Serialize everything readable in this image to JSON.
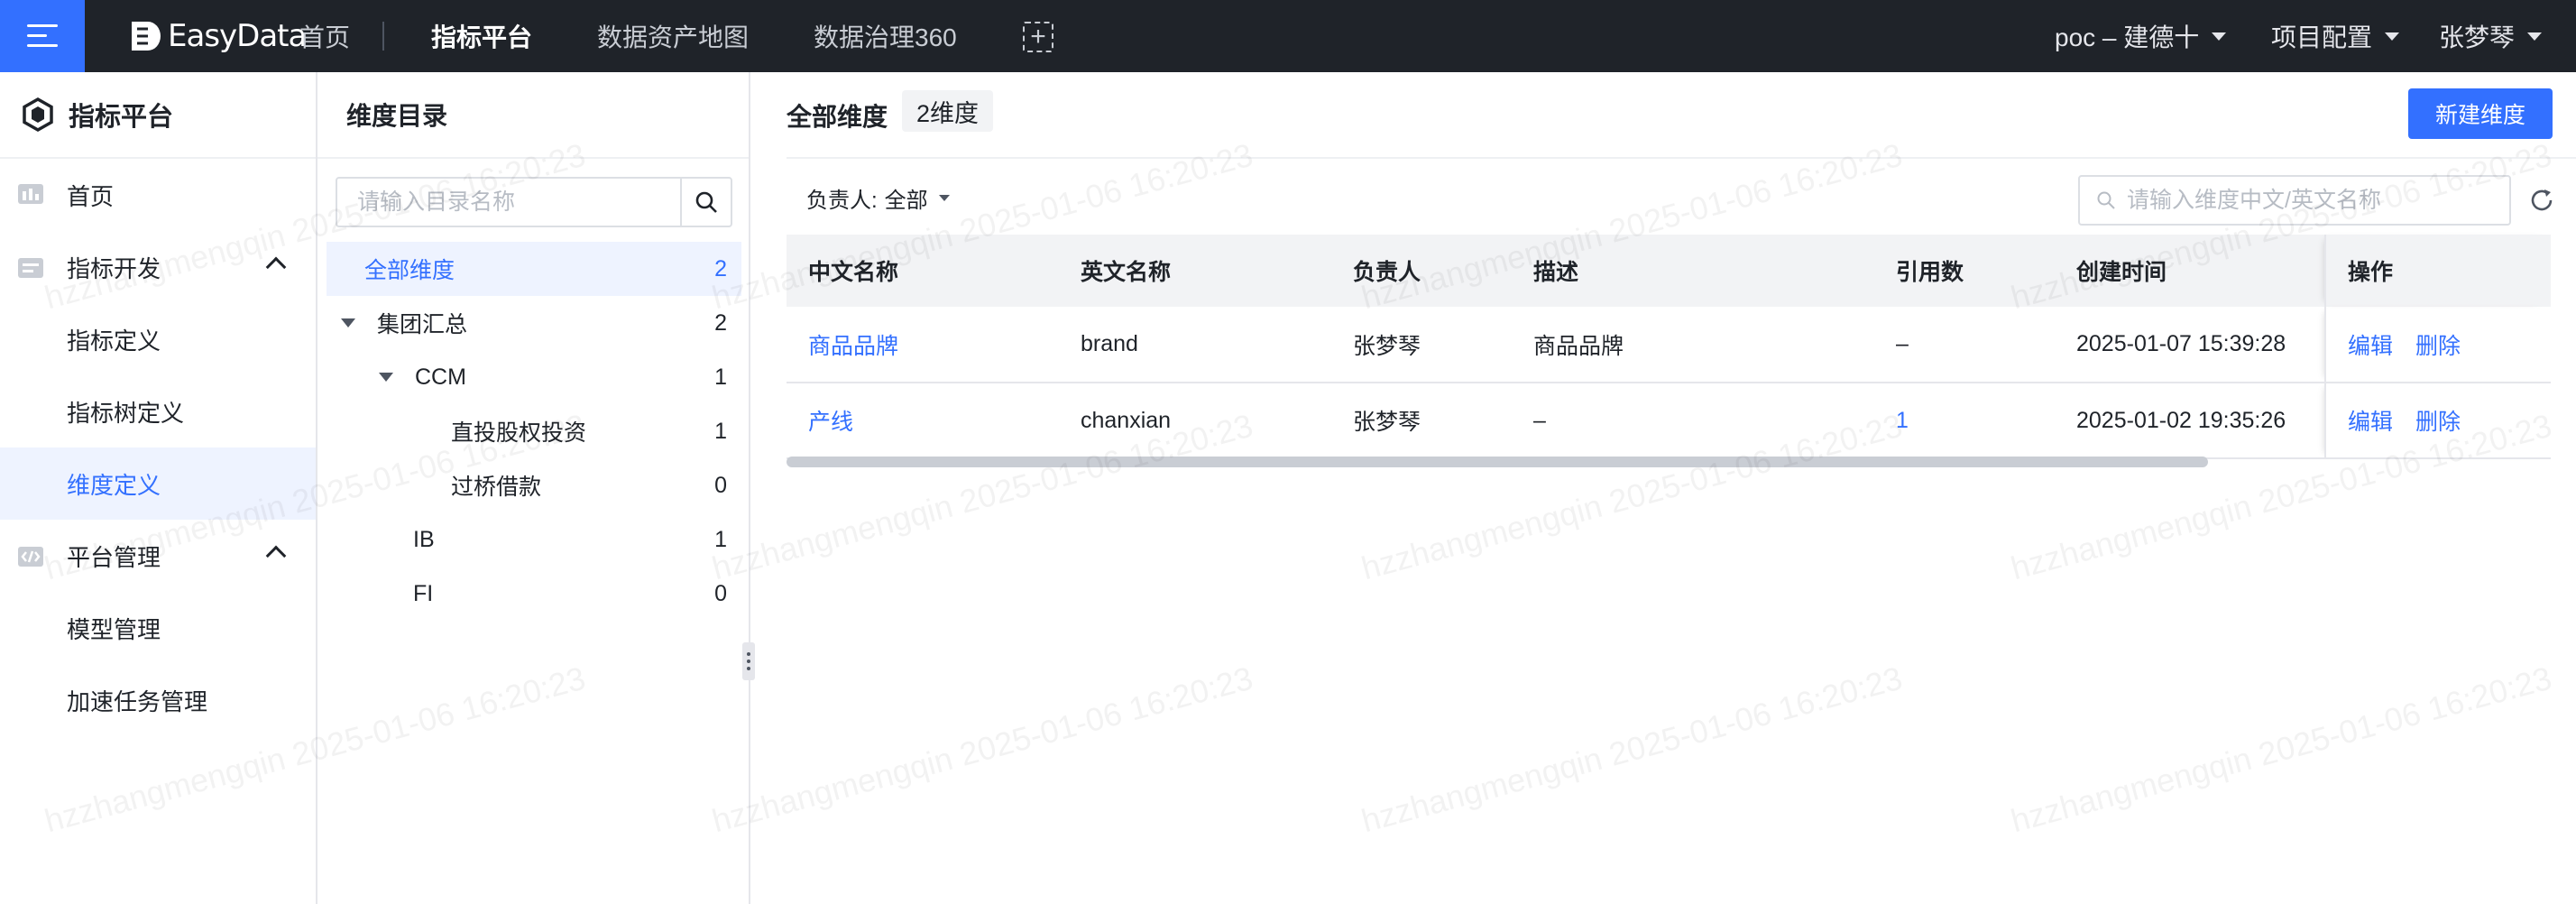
{
  "topbar": {
    "brand": "EasyData",
    "nav": [
      "首页",
      "指标平台",
      "数据资产地图",
      "数据治理360"
    ],
    "add_tab": "+",
    "project": "poc – 建德十",
    "project_config": "项目配置",
    "user": "张梦琴"
  },
  "sidebar": {
    "title": "指标平台",
    "items": {
      "home": "首页",
      "dev_group": "指标开发",
      "metric_def": "指标定义",
      "metric_tree": "指标树定义",
      "dim_def": "维度定义",
      "platform_group": "平台管理",
      "model_mgmt": "模型管理",
      "accel_task": "加速任务管理"
    }
  },
  "directory": {
    "title": "维度目录",
    "search_placeholder": "请输入目录名称",
    "tree": [
      {
        "label": "全部维度",
        "count": "2"
      },
      {
        "label": "集团汇总",
        "count": "2"
      },
      {
        "label": "CCM",
        "count": "1"
      },
      {
        "label": "直投股权投资",
        "count": "1"
      },
      {
        "label": "过桥借款",
        "count": "0"
      },
      {
        "label": "IB",
        "count": "1"
      },
      {
        "label": "FI",
        "count": "0"
      }
    ]
  },
  "main": {
    "title": "全部维度",
    "count_badge": "2维度",
    "new_button": "新建维度",
    "owner_filter": {
      "label": "负责人:",
      "value": "全部"
    },
    "search_placeholder": "请输入维度中文/英文名称",
    "table": {
      "headers": [
        "中文名称",
        "英文名称",
        "负责人",
        "描述",
        "引用数",
        "创建时间",
        "操作"
      ],
      "rows": [
        {
          "cn": "商品品牌",
          "en": "brand",
          "owner": "张梦琴",
          "desc": "商品品牌",
          "refs": "–",
          "created": "2025-01-07 15:39:28",
          "edit": "编辑",
          "delete": "删除"
        },
        {
          "cn": "产线",
          "en": "chanxian",
          "owner": "张梦琴",
          "desc": "–",
          "refs": "1",
          "created": "2025-01-02 19:35:26",
          "edit": "编辑",
          "delete": "删除"
        }
      ]
    }
  },
  "watermark": "hzzhangmengqin 2025-01-06 16:20:23",
  "colors": {
    "accent": "#3370ff",
    "topbar": "#1f2329",
    "active_bg": "#eef3ff"
  }
}
